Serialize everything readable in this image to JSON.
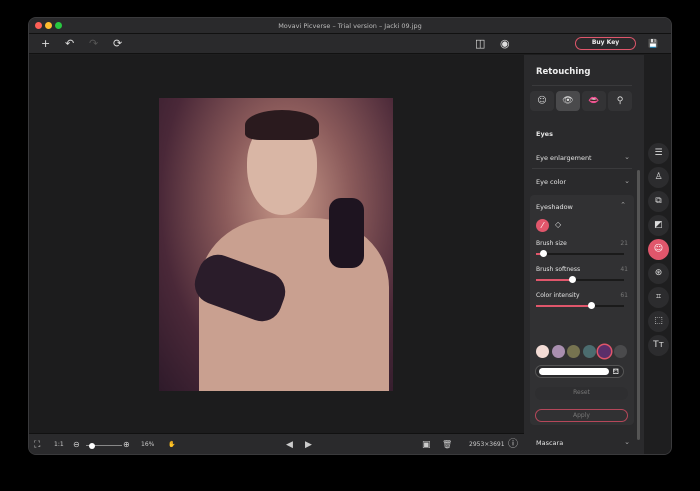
{
  "window": {
    "title": "Movavi Picverse – Trial version – Jacki 09.jpg"
  },
  "toolbar": {
    "add": "+",
    "undo": "↶",
    "redo": "↷",
    "rotate": "⟳",
    "compare": "◫",
    "preview": "◉",
    "buy_key": "Buy Key",
    "save": "💾"
  },
  "bottom": {
    "fit": "⛶",
    "one_to_one": "1:1",
    "zoom_out": "⊖",
    "zoom_in": "⊕",
    "zoom_level": "16%",
    "hand": "✋",
    "prev": "◀",
    "next": "▶",
    "image": "▣",
    "delete": "🗑",
    "dimensions": "2953×3691",
    "info": "ⓘ",
    "zoom_fraction": 0.1
  },
  "panel": {
    "title": "Retouching",
    "segments": [
      "☺",
      "👁",
      "👄",
      "⚲"
    ],
    "section": "Eyes",
    "items": [
      {
        "label": "Eye enlargement"
      },
      {
        "label": "Eye color"
      }
    ],
    "eyeshadow": {
      "label": "Eyeshadow",
      "brush": "⁄",
      "eraser": "◇",
      "sliders": [
        {
          "label": "Brush size",
          "value": "21",
          "fraction": 0.09
        },
        {
          "label": "Brush softness",
          "value": "41",
          "fraction": 0.42
        },
        {
          "label": "Color intensity",
          "value": "61",
          "fraction": 0.63
        }
      ],
      "swatches": [
        "#f3dcd6",
        "#a98fb0",
        "#767350",
        "#4b6c6f",
        "#5b2f6a",
        "#4a4a4c"
      ],
      "fill_icon": "⛾",
      "reset": "Reset",
      "apply": "Apply"
    },
    "mascara": "Mascara",
    "chev_down": "⌄",
    "chev_up": "⌃"
  },
  "strip": [
    "☰",
    "♙",
    "⧉",
    "◩",
    "☺",
    "⊛",
    "⌗",
    "⬚",
    "Tт"
  ],
  "colors": {
    "accent": "#e0566b"
  }
}
